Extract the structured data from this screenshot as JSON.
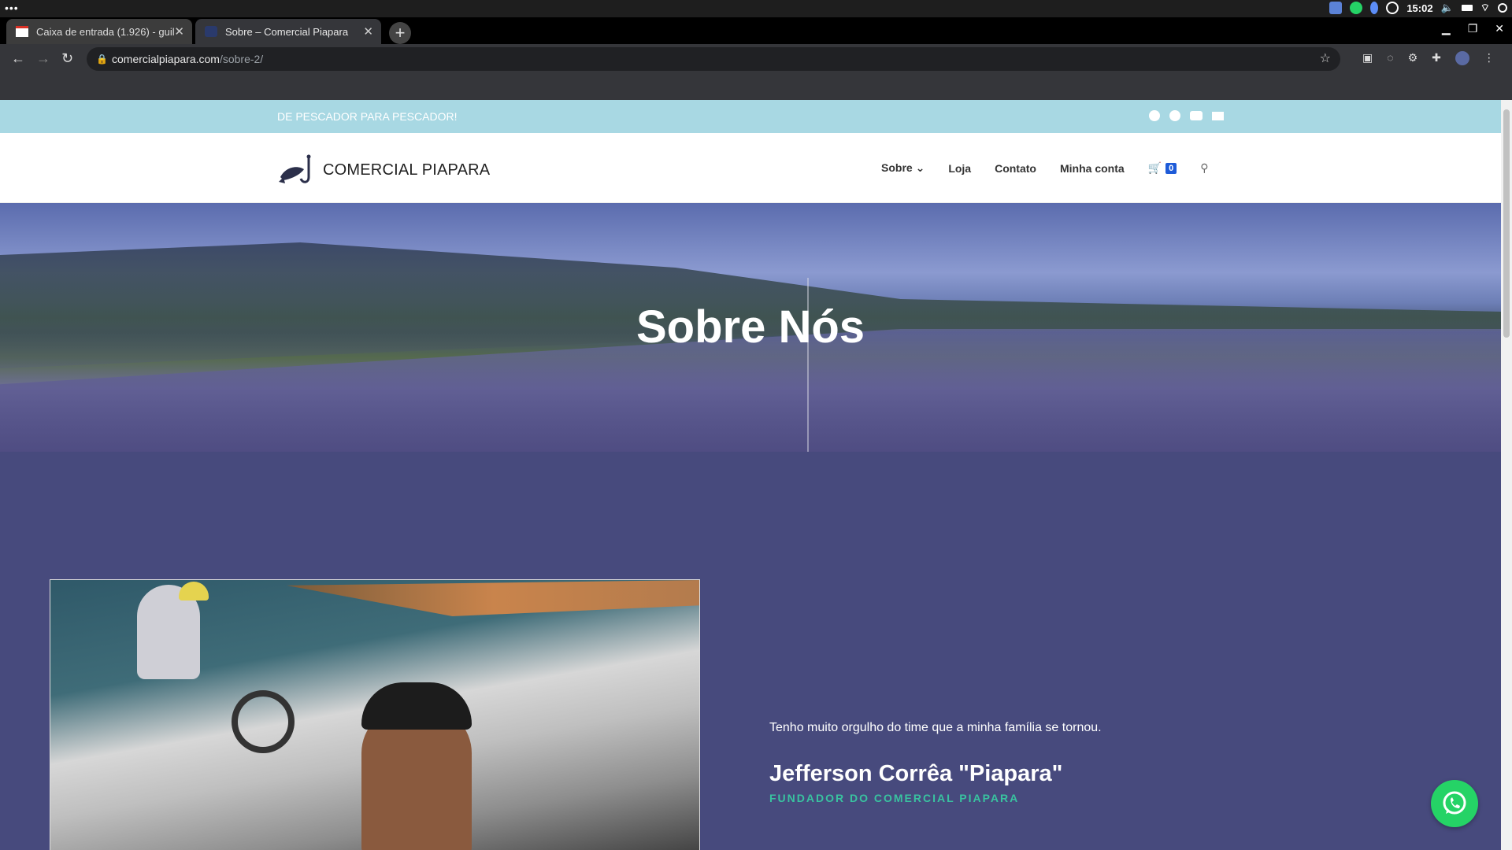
{
  "system": {
    "clock": "15:02",
    "menu_dots": "•••"
  },
  "tabs": [
    {
      "title": "Caixa de entrada (1.926) - guil",
      "active": false,
      "icon": "gmail-icon"
    },
    {
      "title": "Sobre – Comercial Piapara",
      "active": true,
      "icon": "site-favicon-icon"
    }
  ],
  "browser": {
    "url_domain": "comercialpiapara.com",
    "url_path": "/sobre-2/",
    "new_tab": "+",
    "close": "✕"
  },
  "site": {
    "tagline": "DE PESCADOR PARA PESCADOR!",
    "brand": "COMERCIAL PIAPARA",
    "nav": {
      "sobre": "Sobre",
      "loja": "Loja",
      "contato": "Contato",
      "minha_conta": "Minha conta",
      "cart_count": "0"
    },
    "hero_title": "Sobre Nós",
    "quote": "Tenho muito orgulho do time que a minha família se tornou.",
    "founder_name": "Jefferson Corrêa \"Piapara\"",
    "founder_role": "FUNDADOR DO COMERCIAL PIAPARA"
  },
  "colors": {
    "topbar": "#a8d8e3",
    "content_bg": "#474a7d",
    "accent": "#39c3a0",
    "cart_badge": "#1e5bd8",
    "whatsapp": "#25d366"
  }
}
